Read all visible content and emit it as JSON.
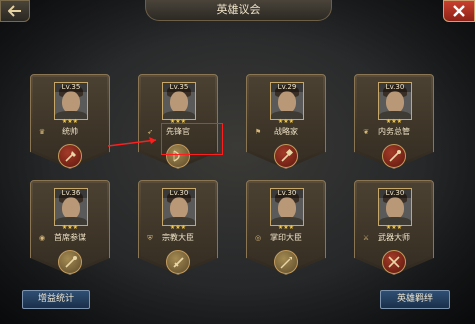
{
  "header": {
    "title": "英雄议会"
  },
  "cards": [
    {
      "level": "Lv.35",
      "role": "统帅",
      "role_icon": "crown-icon",
      "skill_icon": "axe-icon",
      "skill_style": "red"
    },
    {
      "level": "Lv.35",
      "role": "先锋官",
      "role_icon": "arrow-icon",
      "skill_icon": "bow-icon",
      "skill_style": "gold"
    },
    {
      "level": "Lv.29",
      "role": "战略家",
      "role_icon": "flag-icon",
      "skill_icon": "hammer-icon",
      "skill_style": "red"
    },
    {
      "level": "Lv.30",
      "role": "内务总管",
      "role_icon": "laurel-icon",
      "skill_icon": "staff-icon",
      "skill_style": "red"
    },
    {
      "level": "Lv.36",
      "role": "首席参谋",
      "role_icon": "eye-icon",
      "skill_icon": "staff-icon",
      "skill_style": "gold"
    },
    {
      "level": "Lv.30",
      "role": "宗教大臣",
      "role_icon": "shield-icon",
      "skill_icon": "sword-icon",
      "skill_style": "gold"
    },
    {
      "level": "Lv.30",
      "role": "掌印大臣",
      "role_icon": "ring-icon",
      "skill_icon": "spear-icon",
      "skill_style": "gold"
    },
    {
      "level": "Lv.30",
      "role": "武器大师",
      "role_icon": "crossed-swords-icon",
      "skill_icon": "crossed-swords-icon",
      "skill_style": "red"
    }
  ],
  "footer": {
    "stats_label": "增益统计",
    "bond_label": "英雄羁绊"
  }
}
